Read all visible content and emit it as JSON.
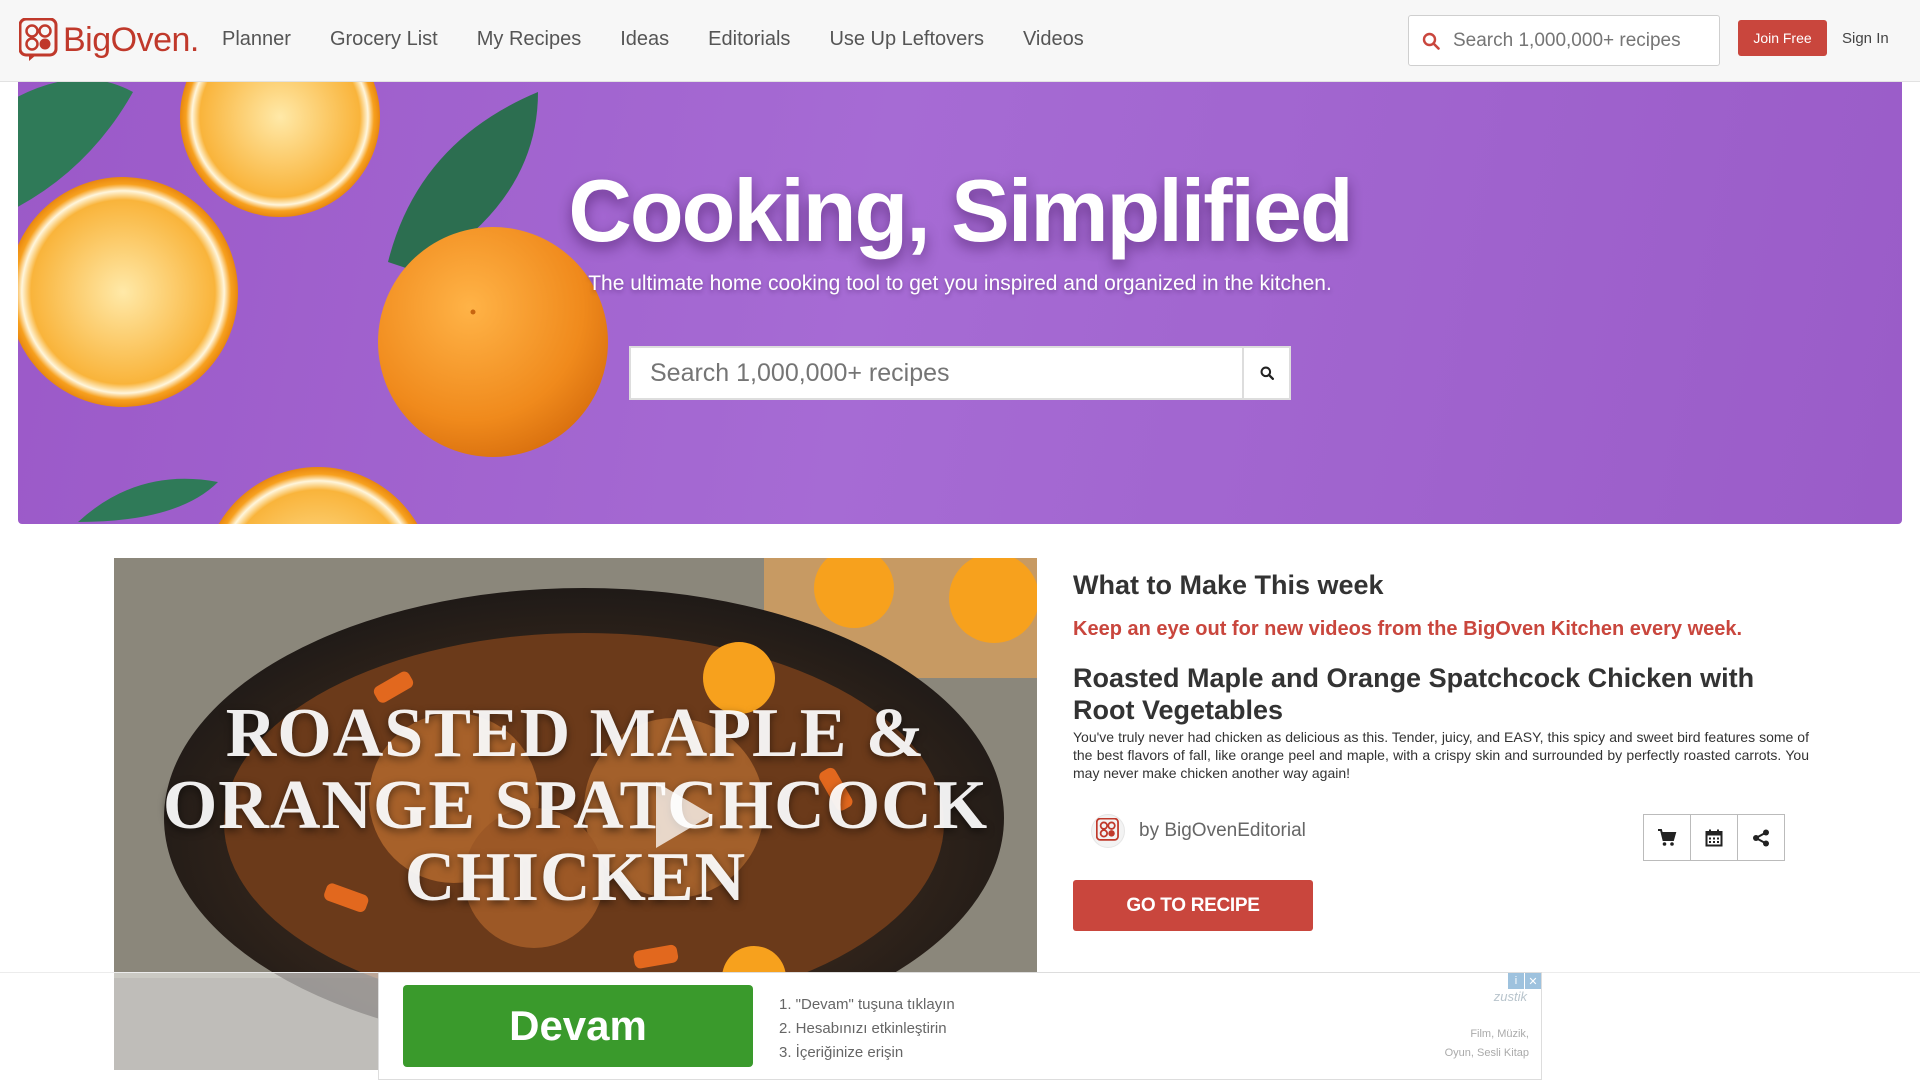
{
  "header": {
    "logo_text": "BigOven",
    "logo_dot": ".",
    "nav": [
      "Planner",
      "Grocery List",
      "My Recipes",
      "Ideas",
      "Editorials",
      "Use Up Leftovers",
      "Videos"
    ],
    "search_placeholder": "Search 1,000,000+ recipes",
    "join_label": "Join Free",
    "signin_label": "Sign In"
  },
  "hero": {
    "title": "Cooking, Simplified",
    "subtitle": "The ultimate home cooking tool to get you inspired and organized in the kitchen.",
    "search_placeholder": "Search 1,000,000+ recipes"
  },
  "feature": {
    "video_title_lines": [
      "ROASTED MAPLE &",
      "ORANGE SPATCHCOCK",
      "CHICKEN"
    ],
    "section_title": "What to Make This week",
    "tagline": "Keep an eye out for new videos from the BigOven Kitchen every week.",
    "recipe_title": "Roasted Maple and Orange Spatchcock Chicken with Root Vegetables",
    "description": "You've truly never had chicken as delicious as this. Tender, juicy, and EASY, this spicy and sweet bird features some of the best flavors of fall, like orange peel and maple, with a crispy skin and surrounded by perfectly roasted carrots. You may never make chicken another way again!",
    "author": "by BigOvenEditorial",
    "cta_label": "GO TO RECIPE"
  },
  "ad": {
    "button_label": "Devam",
    "steps": [
      "1. \"Devam\" tuşuna tıklayın",
      "2. Hesabınızı etkinleştirin",
      "3. İçeriğinize erişin"
    ],
    "brand": "zustik",
    "meta_line1": "Film, Müzik,",
    "meta_line2": "Oyun, Sesli Kitap"
  },
  "colors": {
    "brand_red": "#c9463d",
    "hero_purple": "#a66bd4",
    "ad_green": "#3a9a2c"
  }
}
